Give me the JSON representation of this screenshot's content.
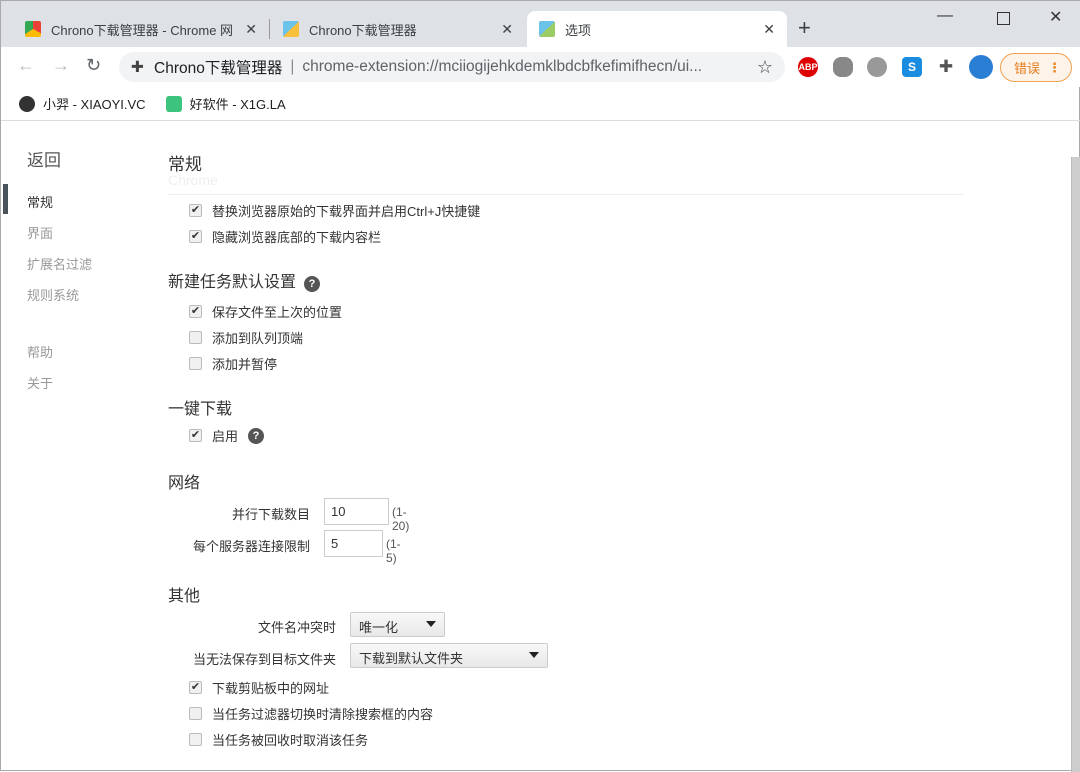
{
  "tabs": [
    {
      "label": "Chrono下载管理器 - Chrome 网"
    },
    {
      "label": "Chrono下载管理器"
    },
    {
      "label": "选项"
    }
  ],
  "address": {
    "title": "Chrono下载管理器",
    "sep": "|",
    "url": "chrome-extension://mciiogijehkdemklbdcbfkefimifhecn/ui..."
  },
  "extensions": {
    "abp": "ABP",
    "s": "S"
  },
  "error_button": "错误",
  "bookmarks": [
    {
      "label": "小羿 - XIAOYI.VC"
    },
    {
      "label": "好软件 - X1G.LA"
    }
  ],
  "sidebar": {
    "back": "返回",
    "items": [
      "常规",
      "界面",
      "扩展名过滤",
      "规则系统"
    ],
    "items2": [
      "帮助",
      "关于"
    ]
  },
  "general": {
    "title": "常规",
    "subtitle": "Chrome",
    "options": [
      {
        "label": "替换浏览器原始的下载界面并启用Ctrl+J快捷键",
        "checked": true
      },
      {
        "label": "隐藏浏览器底部的下载内容栏",
        "checked": true
      }
    ]
  },
  "new_task": {
    "title": "新建任务默认设置",
    "options": [
      {
        "label": "保存文件至上次的位置",
        "checked": true
      },
      {
        "label": "添加到队列顶端",
        "checked": false
      },
      {
        "label": "添加并暂停",
        "checked": false
      }
    ]
  },
  "one_click": {
    "title": "一键下载",
    "enable": "启用",
    "checked": true
  },
  "network": {
    "title": "网络",
    "parallel_label": "并行下载数目",
    "parallel_value": "10",
    "parallel_range": "(1-20)",
    "per_server_label": "每个服务器连接限制",
    "per_server_value": "5",
    "per_server_range": "(1-5)"
  },
  "other": {
    "title": "其他",
    "conflict_label": "文件名冲突时",
    "conflict_value": "唯一化",
    "cannot_save_label": "当无法保存到目标文件夹",
    "cannot_save_value": "下载到默认文件夹",
    "options": [
      {
        "label": "下载剪贴板中的网址",
        "checked": true
      },
      {
        "label": "当任务过滤器切换时清除搜索框的内容",
        "checked": false
      },
      {
        "label": "当任务被回收时取消该任务",
        "checked": false
      }
    ]
  },
  "help_glyph": "?",
  "check_glyph": "✔"
}
